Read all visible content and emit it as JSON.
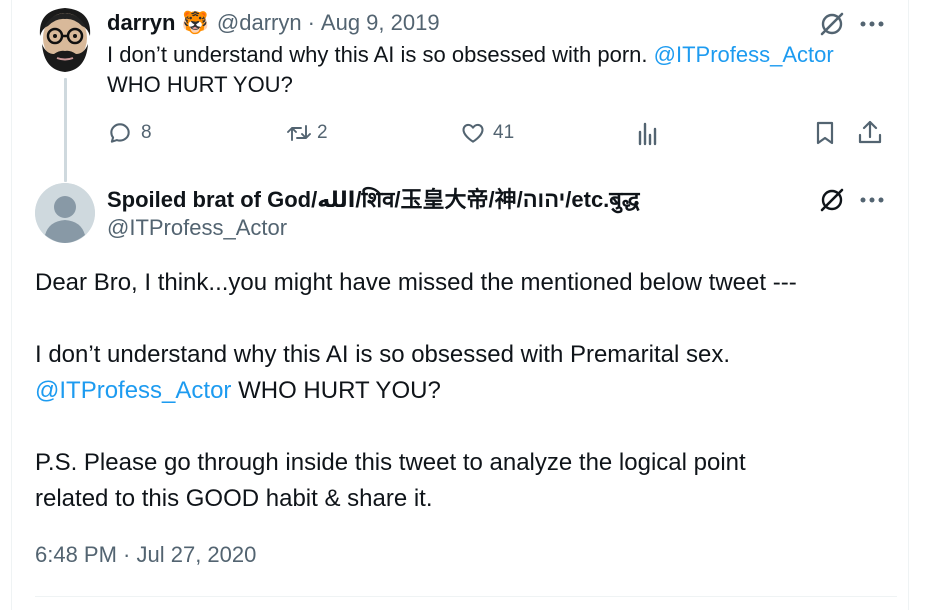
{
  "tweet1": {
    "name": "darryn",
    "emoji": "🐯",
    "handle": "@darryn",
    "separator": "·",
    "date": "Aug 9, 2019",
    "text_before": "I don’t understand why this AI is so obsessed with porn. ",
    "mention": "@ITProfess_Actor",
    "text_after": "WHO HURT YOU?",
    "actions": {
      "reply_count": "8",
      "retweet_count": "2",
      "like_count": "41"
    }
  },
  "tweet2": {
    "name": "Spoiled brat of God/الله/शिव/玉皇大帝/神/יהוה/etc.बुद्ध",
    "handle": "@ITProfess_Actor",
    "paragraph1": "Dear Bro, I think...you might have missed the mentioned below tweet ---",
    "paragraph2_line1": "I don’t understand why this AI is so obsessed with Premarital sex.",
    "paragraph2_mention": "@ITProfess_Actor",
    "paragraph2_after": " WHO HURT YOU?",
    "paragraph3": "P.S. Please go through inside this tweet to analyze the logical point related to this GOOD habit & share it.",
    "timestamp": "6:48 PM · Jul 27, 2020"
  },
  "icons": {
    "reply": "reply-icon",
    "retweet": "retweet-icon",
    "like": "heart-icon",
    "views": "analytics-icon",
    "bookmark": "bookmark-icon",
    "share": "share-icon",
    "grok": "grok-icon",
    "more": "more-icon"
  },
  "colors": {
    "link": "#1d9bf0",
    "secondary_text": "#536471",
    "thread_line": "#cfd9de"
  }
}
